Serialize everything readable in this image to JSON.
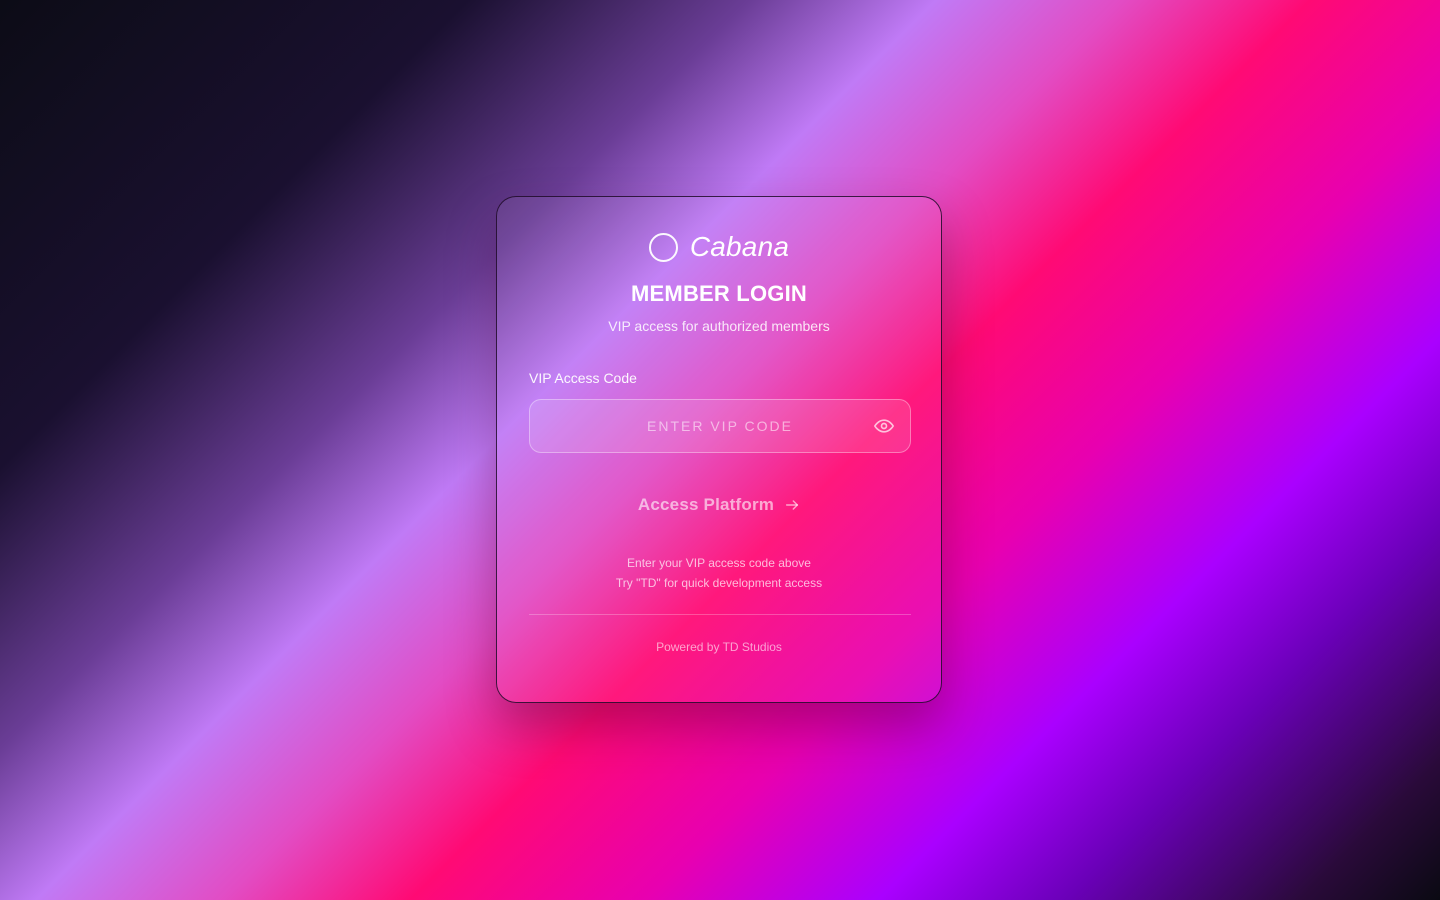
{
  "brand": {
    "name": "Cabana",
    "logo_icon": "circle-outline-icon"
  },
  "login": {
    "title": "MEMBER LOGIN",
    "subtitle": "VIP access for authorized members",
    "field_label": "VIP Access Code",
    "input_value": "",
    "input_placeholder": "ENTER VIP CODE",
    "toggle_icon": "eye-icon",
    "submit_label": "Access Platform",
    "submit_icon": "arrow-right-icon",
    "hint_line1": "Enter your VIP access code above",
    "hint_line2": "Try \"TD\" for quick development access"
  },
  "footer": {
    "text": "Powered by TD Studios"
  },
  "colors": {
    "pink": "#ff0a74",
    "magenta": "#e800b0",
    "violet": "#aa00ff",
    "lavender": "#c07af6",
    "dark": "#0c0c16"
  }
}
